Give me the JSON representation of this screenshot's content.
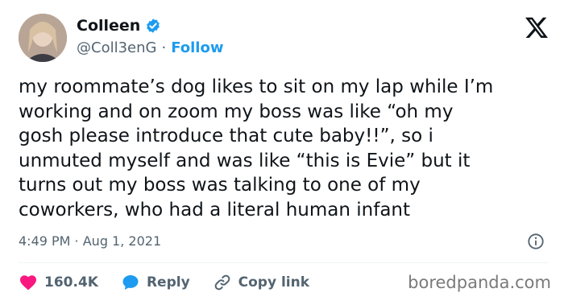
{
  "user": {
    "display_name": "Colleen",
    "handle": "@Coll3enG",
    "separator": "·",
    "follow_label": "Follow"
  },
  "tweet": {
    "text": "my roommate’s dog likes to sit on my lap while I’m\nworking and on zoom my boss was like “oh my\ngosh please introduce that cute baby!!”, so i\nunmuted myself and was like “this is Evie” but it\nturns out my boss was talking to one of my\ncoworkers, who had a literal human infant",
    "timestamp": "4:49 PM · Aug 1, 2021"
  },
  "actions": {
    "likes_count": "160.4K",
    "reply_label": "Reply",
    "copy_link_label": "Copy link"
  },
  "watermark": "boredpanda.com",
  "icons": {
    "verified": "verified-badge-icon",
    "logo": "x-logo-icon",
    "info": "info-icon",
    "like": "heart-icon",
    "reply": "reply-bubble-icon",
    "copy": "link-icon"
  },
  "colors": {
    "accent": "#1d9bf0",
    "like": "#f91880",
    "muted": "#536471",
    "text": "#0f1419"
  }
}
